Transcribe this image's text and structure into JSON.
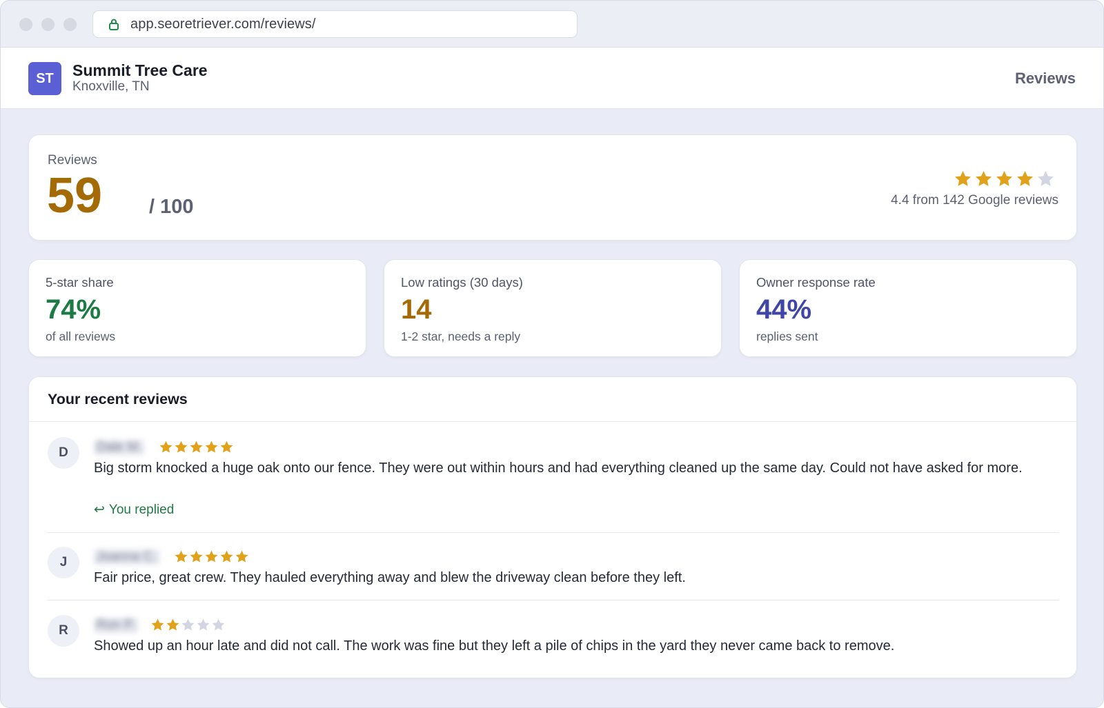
{
  "browser": {
    "url": "app.seoretriever.com/reviews/"
  },
  "header": {
    "logo_initials": "ST",
    "business_name": "Summit Tree Care",
    "location": "Knoxville, TN",
    "nav_label": "Reviews"
  },
  "score": {
    "label": "Reviews",
    "value": "59",
    "out_of": "/ 100",
    "star_rating": 4.4,
    "rating_summary": "4.4 from 142 Google reviews"
  },
  "stats": [
    {
      "label": "5-star share",
      "value": "74%",
      "sub": "of all reviews",
      "color": "#1c7a43"
    },
    {
      "label": "Low ratings (30 days)",
      "value": "14",
      "sub": "1-2 star, needs a reply",
      "color": "#a46a06"
    },
    {
      "label": "Owner response rate",
      "value": "44%",
      "sub": "replies sent",
      "color": "#3f46a8"
    }
  ],
  "recent_reviews": {
    "title": "Your recent reviews",
    "items": [
      {
        "initial": "D",
        "name": "Dale M.",
        "stars": 5,
        "text": "Big storm knocked a huge oak onto our fence. They were out within hours and had everything cleaned up the same day. Could not have asked for more.",
        "reply": "You replied"
      },
      {
        "initial": "J",
        "name": "Joanna C.",
        "stars": 5,
        "text": "Fair price, great crew. They hauled everything away and blew the driveway clean before they left."
      },
      {
        "initial": "R",
        "name": "Ron P.",
        "stars": 2,
        "text": "Showed up an hour late and did not call. The work was fine but they left a pile of chips in the yard they never came back to remove."
      }
    ]
  },
  "colors": {
    "star_filled": "#e0a21b",
    "star_empty": "#d3d6e2",
    "accent": "#5b5fd4"
  },
  "icons": {
    "lock": "lock-icon",
    "reply": "reply-arrow-icon",
    "star": "star-icon"
  }
}
